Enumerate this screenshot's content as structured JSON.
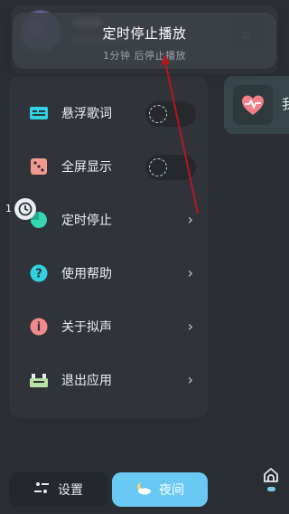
{
  "toast": {
    "title": "定时停止播放",
    "subtitle": "1分钟 后停止播放"
  },
  "menu": {
    "items": [
      {
        "label": "悬浮歌词",
        "icon": "subtitle-icon",
        "has_toggle": true,
        "toggle_on": false,
        "color": "#2fd1e2"
      },
      {
        "label": "全屏显示",
        "icon": "dice-icon",
        "has_toggle": true,
        "toggle_on": false,
        "color": "#f29a8e"
      },
      {
        "label": "定时停止",
        "icon": "timer-icon",
        "has_toggle": false,
        "color": "#34d6b5"
      },
      {
        "label": "使用帮助",
        "icon": "question-icon",
        "has_toggle": false,
        "color": "#2fd1e2"
      },
      {
        "label": "关于拟声",
        "icon": "info-icon",
        "has_toggle": false,
        "color": "#f08a8a"
      },
      {
        "label": "退出应用",
        "icon": "exit-icon",
        "has_toggle": false,
        "color": "#b8e3a4"
      }
    ],
    "chevron": "›"
  },
  "right_card": {
    "label": "我",
    "icon": "heart-pulse-icon"
  },
  "float_badge": {
    "count": "1",
    "icon": "alarm-clock-icon"
  },
  "header": {
    "right_icon": "double-chevron-right-icon"
  },
  "bottom": {
    "settings_label": "设置",
    "night_label": "夜间",
    "settings_icon": "sliders-icon",
    "night_icon": "moon-cloud-icon",
    "home_icon": "home-icon"
  }
}
